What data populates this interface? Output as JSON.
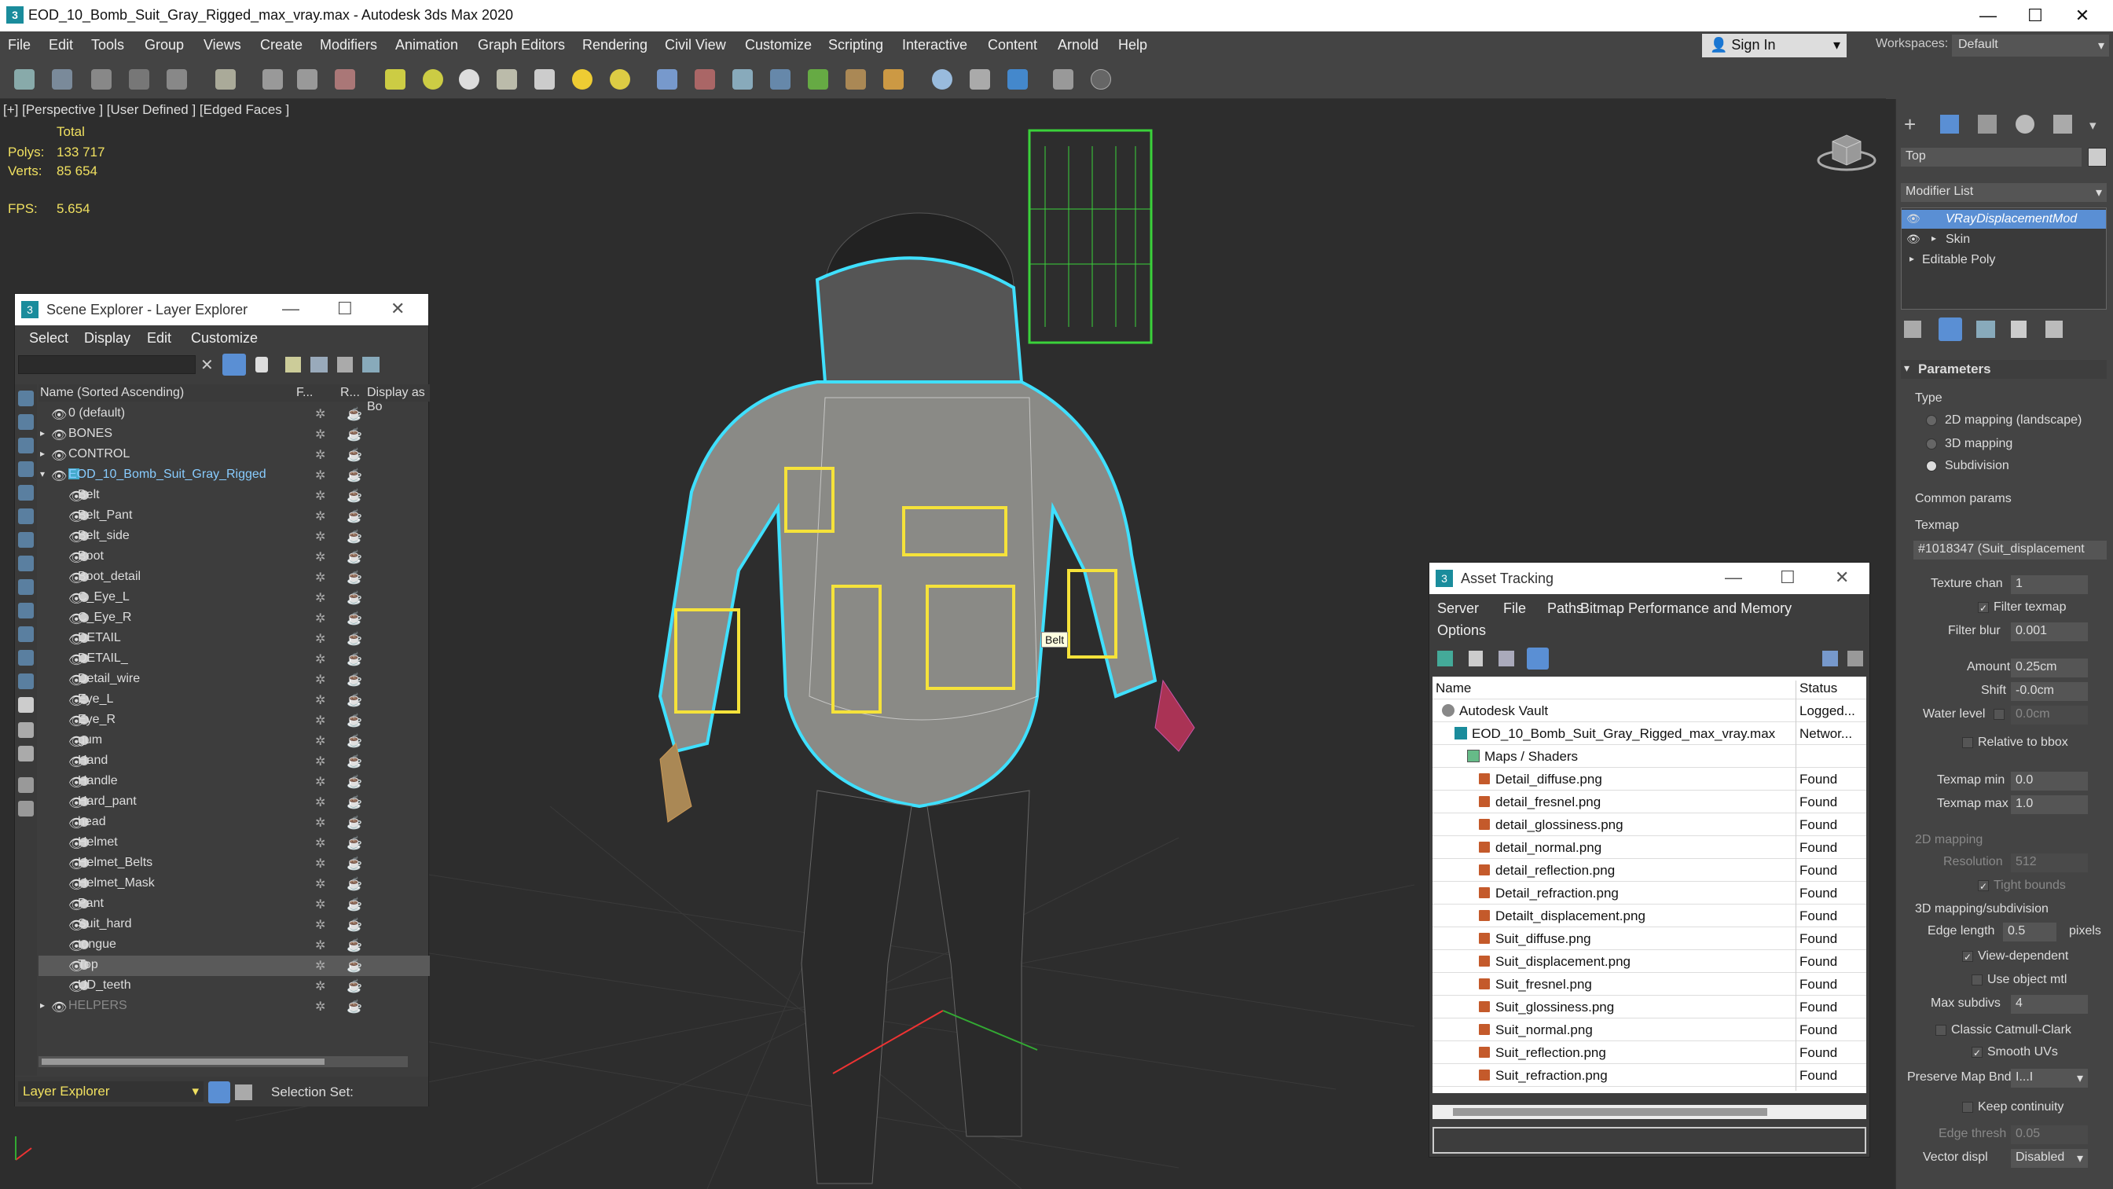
{
  "window": {
    "title": "EOD_10_Bomb_Suit_Gray_Rigged_max_vray.max - Autodesk 3ds Max 2020",
    "minimize": "—",
    "maximize": "☐",
    "close": "✕"
  },
  "menu": [
    "File",
    "Edit",
    "Tools",
    "Group",
    "Views",
    "Create",
    "Modifiers",
    "Animation",
    "Graph Editors",
    "Rendering",
    "Civil View",
    "Customize",
    "Scripting",
    "Interactive",
    "Content",
    "Arnold",
    "Help"
  ],
  "account": {
    "signin": "Sign In",
    "workspaces_label": "Workspaces:",
    "workspace": "Default"
  },
  "viewport": {
    "label": "[+] [Perspective ] [User Defined ] [Edged Faces ]",
    "stats_total": "Total",
    "polys_label": "Polys:",
    "polys": "133 717",
    "verts_label": "Verts:",
    "verts": "85 654",
    "fps_label": "FPS:",
    "fps": "5.654",
    "tooltip": "Belt"
  },
  "scene_explorer": {
    "title": "Scene Explorer - Layer Explorer",
    "menu": [
      "Select",
      "Display",
      "Edit",
      "Customize"
    ],
    "columns": {
      "name": "Name (Sorted Ascending)",
      "f": "F...",
      "r": "R...",
      "display": "Display as Bo"
    },
    "rows": [
      {
        "name": "0 (default)",
        "level": 0,
        "type": "layer"
      },
      {
        "name": "BONES",
        "level": 0,
        "type": "layer"
      },
      {
        "name": "CONTROL",
        "level": 0,
        "type": "layer"
      },
      {
        "name": "EOD_10_Bomb_Suit_Gray_Rigged",
        "level": 0,
        "type": "layer",
        "active": true
      },
      {
        "name": "Belt",
        "level": 1
      },
      {
        "name": "Belt_Pant",
        "level": 1
      },
      {
        "name": "Belt_side",
        "level": 1
      },
      {
        "name": "Boot",
        "level": 1
      },
      {
        "name": "Boot_detail",
        "level": 1
      },
      {
        "name": "C_Eye_L",
        "level": 1
      },
      {
        "name": "C_Eye_R",
        "level": 1
      },
      {
        "name": "DETAIL",
        "level": 1
      },
      {
        "name": "DETAIL_",
        "level": 1
      },
      {
        "name": "Detail_wire",
        "level": 1
      },
      {
        "name": "Eye_L",
        "level": 1
      },
      {
        "name": "Eye_R",
        "level": 1
      },
      {
        "name": "gum",
        "level": 1
      },
      {
        "name": "Hand",
        "level": 1
      },
      {
        "name": "Handle",
        "level": 1
      },
      {
        "name": "Hard_pant",
        "level": 1
      },
      {
        "name": "head",
        "level": 1
      },
      {
        "name": "Helmet",
        "level": 1
      },
      {
        "name": "Helmet_Belts",
        "level": 1
      },
      {
        "name": "Helmet_Mask",
        "level": 1
      },
      {
        "name": "Pant",
        "level": 1
      },
      {
        "name": "Suit_hard",
        "level": 1
      },
      {
        "name": "tongue",
        "level": 1
      },
      {
        "name": "Top",
        "level": 1,
        "selected": true
      },
      {
        "name": "UD_teeth",
        "level": 1
      },
      {
        "name": "HELPERS",
        "level": 0,
        "type": "layer",
        "dim": true
      }
    ],
    "bottom_label": "Layer Explorer",
    "selection_set": "Selection Set:"
  },
  "asset_tracking": {
    "title": "Asset Tracking",
    "menu1": [
      "Server",
      "File",
      "Paths",
      "Bitmap Performance and Memory"
    ],
    "menu2": [
      "Options"
    ],
    "columns": {
      "name": "Name",
      "status": "Status"
    },
    "rows": [
      {
        "name": "Autodesk Vault",
        "status": "Logged...",
        "indent": 0
      },
      {
        "name": "EOD_10_Bomb_Suit_Gray_Rigged_max_vray.max",
        "status": "Networ...",
        "indent": 1
      },
      {
        "name": "Maps / Shaders",
        "status": "",
        "indent": 2
      },
      {
        "name": "Detail_diffuse.png",
        "status": "Found",
        "indent": 3
      },
      {
        "name": "detail_fresnel.png",
        "status": "Found",
        "indent": 3
      },
      {
        "name": "detail_glossiness.png",
        "status": "Found",
        "indent": 3
      },
      {
        "name": "detail_normal.png",
        "status": "Found",
        "indent": 3
      },
      {
        "name": "detail_reflection.png",
        "status": "Found",
        "indent": 3
      },
      {
        "name": "Detail_refraction.png",
        "status": "Found",
        "indent": 3
      },
      {
        "name": "Detailt_displacement.png",
        "status": "Found",
        "indent": 3
      },
      {
        "name": "Suit_diffuse.png",
        "status": "Found",
        "indent": 3
      },
      {
        "name": "Suit_displacement.png",
        "status": "Found",
        "indent": 3
      },
      {
        "name": "Suit_fresnel.png",
        "status": "Found",
        "indent": 3
      },
      {
        "name": "Suit_glossiness.png",
        "status": "Found",
        "indent": 3
      },
      {
        "name": "Suit_normal.png",
        "status": "Found",
        "indent": 3
      },
      {
        "name": "Suit_reflection.png",
        "status": "Found",
        "indent": 3
      },
      {
        "name": "Suit_refraction.png",
        "status": "Found",
        "indent": 3
      }
    ]
  },
  "command_panel": {
    "object_name": "Top",
    "modifier_list": "Modifier List",
    "stack": [
      "VRayDisplacementMod",
      "Skin",
      "Editable Poly"
    ],
    "rollout": "Parameters",
    "type_label": "Type",
    "types": [
      "2D mapping (landscape)",
      "3D mapping",
      "Subdivision"
    ],
    "common_params": "Common params",
    "texmap_label": "Texmap",
    "texmap": "#1018347 (Suit_displacement",
    "texture_chan_label": "Texture chan",
    "texture_chan": "1",
    "filter_texmap": "Filter texmap",
    "filter_blur_label": "Filter blur",
    "filter_blur": "0.001",
    "amount_label": "Amount",
    "amount": "0.25cm",
    "shift_label": "Shift",
    "shift": "-0.0cm",
    "water_level_label": "Water level",
    "water_level": "0.0cm",
    "relative_bbox": "Relative to bbox",
    "texmap_min_label": "Texmap min",
    "texmap_min": "0.0",
    "texmap_max_label": "Texmap max",
    "texmap_max": "1.0",
    "mapping2d": "2D mapping",
    "resolution_label": "Resolution",
    "resolution": "512",
    "tight_bounds": "Tight bounds",
    "mapping3d": "3D mapping/subdivision",
    "edge_length_label": "Edge length",
    "edge_length": "0.5",
    "pixels": "pixels",
    "view_dependent": "View-dependent",
    "use_object_mtl": "Use object mtl",
    "max_subdivs_label": "Max subdivs",
    "max_subdivs": "4",
    "classic_catmull": "Classic Catmull-Clark",
    "smooth_uvs": "Smooth UVs",
    "preserve_map_label": "Preserve Map Bnd",
    "preserve_map": "I...I",
    "keep_continuity": "Keep continuity",
    "edge_thresh_label": "Edge thresh",
    "edge_thresh": "0.05",
    "vector_displ_label": "Vector displ",
    "vector_displ": "Disabled"
  },
  "colors": {
    "accent": "#5a8fd4",
    "wire_cyan": "#3fe0ff",
    "wire_yellow": "#f5e23a",
    "wire_green": "#3ad23a",
    "stat_yellow": "#f0e060"
  }
}
